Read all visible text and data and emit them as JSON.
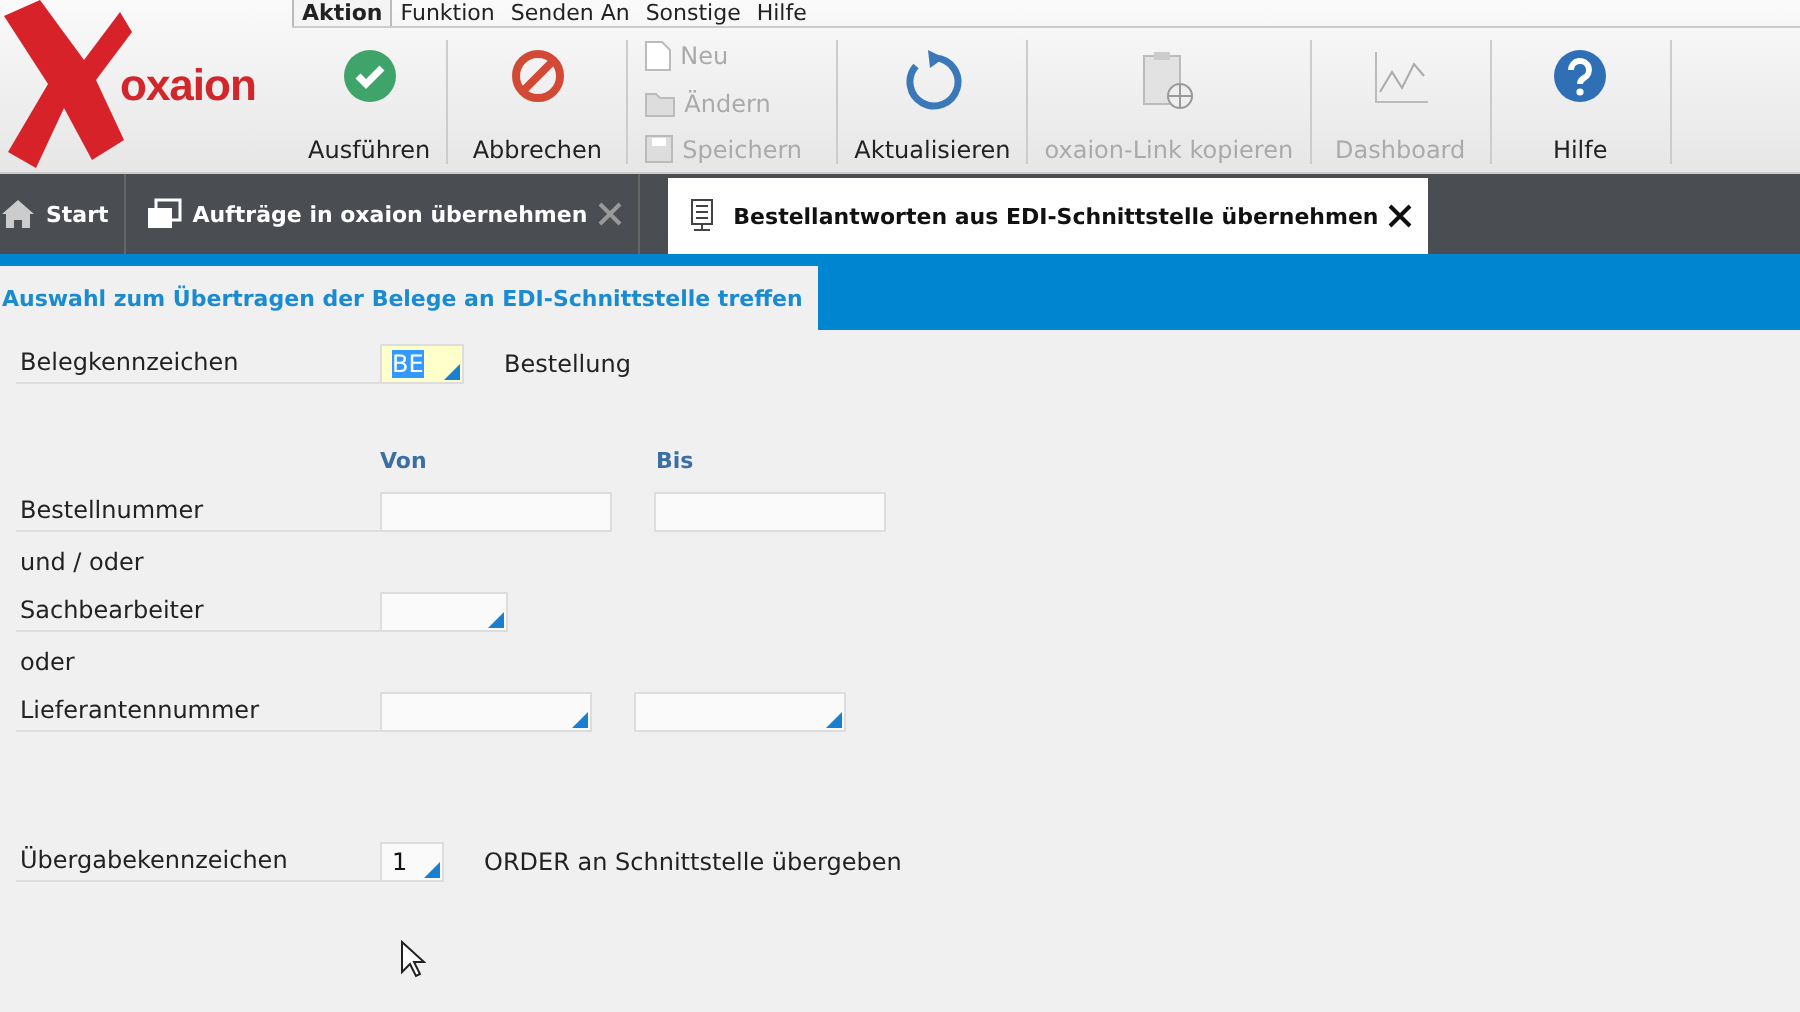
{
  "logo": {
    "text": "oxaion"
  },
  "menu": [
    {
      "label": "Aktion",
      "selected": true
    },
    {
      "label": "Funktion",
      "selected": false
    },
    {
      "label": "Senden An",
      "selected": false
    },
    {
      "label": "Sonstige",
      "selected": false
    },
    {
      "label": "Hilfe",
      "selected": false
    }
  ],
  "toolbar": [
    {
      "kind": "big",
      "label": "Ausführen",
      "disabled": false
    },
    {
      "kind": "big",
      "label": "Abbrechen",
      "disabled": false
    },
    {
      "kind": "stack",
      "items": [
        {
          "label": "Neu",
          "disabled": true
        },
        {
          "label": "Ändern",
          "disabled": true
        },
        {
          "label": "Speichern",
          "disabled": true
        }
      ]
    },
    {
      "kind": "big",
      "label": "Aktualisieren",
      "disabled": false
    },
    {
      "kind": "big",
      "label": "oxaion-Link kopieren",
      "disabled": true
    },
    {
      "kind": "big",
      "label": "Dashboard",
      "disabled": true
    },
    {
      "kind": "big",
      "label": "Hilfe",
      "disabled": false
    }
  ],
  "tabs": [
    {
      "kind": "home",
      "label": "Start",
      "selected": false,
      "closable": false
    },
    {
      "kind": "window",
      "label": "Aufträge in oxaion übernehmen",
      "selected": false,
      "closable": true
    },
    {
      "kind": "program",
      "label": "Bestellantworten aus EDI-Schnittstelle übernehmen",
      "selected": true,
      "closable": true
    }
  ],
  "section": {
    "title": "Auswahl zum Übertragen der Belege an EDI-Schnittstelle treffen"
  },
  "form": [
    {
      "kind": "field",
      "label": "Belegkennzeichen",
      "fields": [
        {
          "value": "BE",
          "lookup": true,
          "focused": true
        }
      ],
      "description": "Bestellung"
    },
    {
      "kind": "header",
      "columns": [
        "Von",
        "Bis"
      ]
    },
    {
      "kind": "field",
      "label": "Bestellnummer",
      "fields": [
        {
          "lookup": false,
          "focused": false
        },
        {
          "lookup": false,
          "focused": false
        }
      ]
    },
    {
      "kind": "text",
      "label": "und / oder"
    },
    {
      "kind": "field",
      "label": "Sachbearbeiter",
      "fields": [
        {
          "lookup": true,
          "focused": false
        }
      ]
    },
    {
      "kind": "text",
      "label": "oder"
    },
    {
      "kind": "field",
      "label": "Lieferantennummer",
      "fields": [
        {
          "lookup": true,
          "focused": false
        },
        {
          "lookup": true,
          "focused": false
        }
      ]
    },
    {
      "kind": "field",
      "label": "Übergabekennzeichen",
      "fields": [
        {
          "value": "1",
          "lookup": true,
          "focused": false
        }
      ],
      "description": "ORDER an Schnittstelle übergeben"
    }
  ]
}
